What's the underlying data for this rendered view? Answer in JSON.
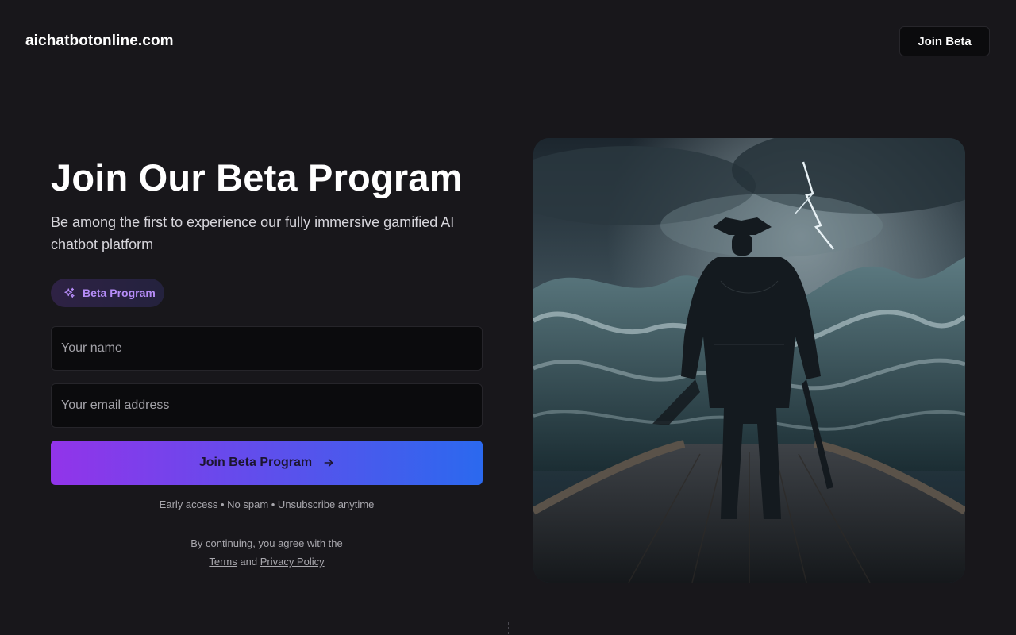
{
  "header": {
    "brand": "aichatbotonline.com",
    "cta_label": "Join Beta"
  },
  "hero": {
    "title": "Join Our Beta Program",
    "subtitle": "Be among the first to experience our fully immersive gamified AI chatbot platform"
  },
  "badge": {
    "icon": "sparkles-icon",
    "label": "Beta Program"
  },
  "form": {
    "name_placeholder": "Your name",
    "name_value": "",
    "email_placeholder": "Your email address",
    "email_value": "",
    "submit_label": "Join Beta Program",
    "submit_icon": "arrow-right-icon"
  },
  "perks": "Early access • No spam • Unsubscribe anytime",
  "legal": {
    "prefix": "By continuing, you agree with the",
    "terms_label": "Terms",
    "and": "and",
    "privacy_label": "Privacy Policy"
  },
  "colors": {
    "background": "#18171b",
    "input_background": "#0b0b0d",
    "badge_text": "#b58cf7",
    "gradient_start": "#9234ea",
    "gradient_end": "#2b69ee"
  }
}
